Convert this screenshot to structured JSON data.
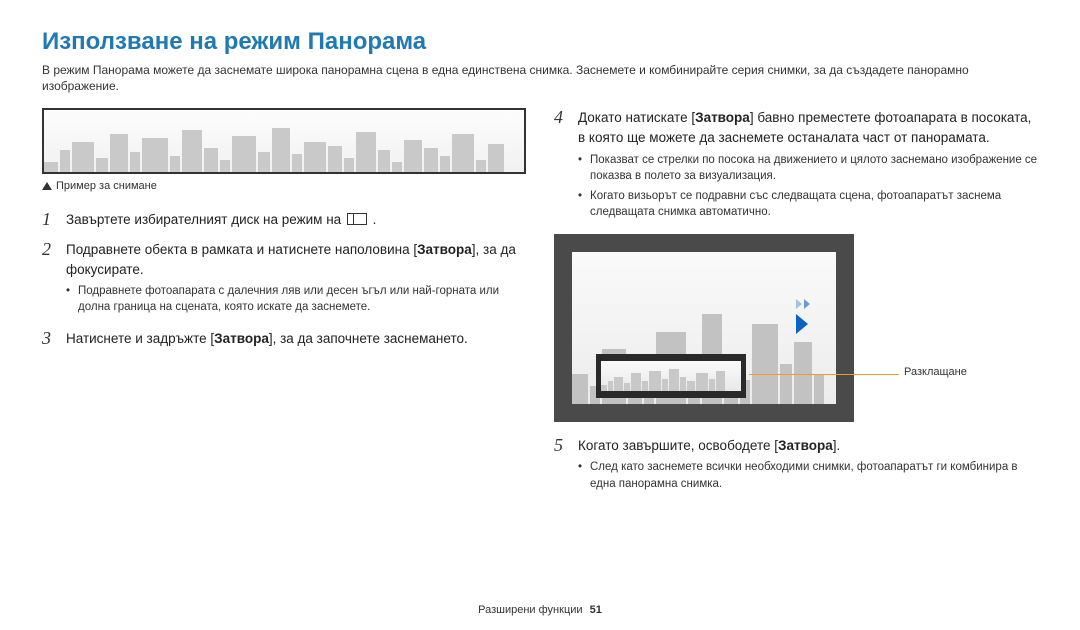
{
  "title": "Използване на режим Панорама",
  "intro": "В режим Панорама можете да заснемате широка панорамна сцена в една единствена снимка. Заснемете и комбинирайте серия снимки, за да създадете панорамно изображение.",
  "example_caption": "Пример за снимане",
  "steps_left": {
    "s1": "Завъртете избирателният диск на режим на ",
    "s1_after": " .",
    "s2_a": "Подравнете обекта в рамката и натиснете наполовина [",
    "s2_bold": "Затвора",
    "s2_b": "], за да фокусирате.",
    "s2_sub1": "Подравнете фотоапарата с далечния ляв или десен ъгъл или най-горната или долна граница на сцената, която искате да заснемете.",
    "s3_a": "Натиснете и задръжте [",
    "s3_bold": "Затвора",
    "s3_b": "], за да започнете заснемането."
  },
  "steps_right": {
    "s4_a": "Докато натискате [",
    "s4_bold": "Затвора",
    "s4_b": "] бавно преместете фотоапарата в посоката, в която ще можете да заснемете останалата част от панорамата.",
    "s4_sub1": "Показват се стрелки по посока на движението и цялото заснемано изображение се показва в полето за визуализация.",
    "s4_sub2": "Когато визьорът се подравни със следващата сцена, фотоапаратът заснема следващата снимка автоматично.",
    "s5_a": "Когато завършите, освободете [",
    "s5_bold": "Затвора",
    "s5_b": "].",
    "s5_sub1": "След като заснемете всички необходими снимки, фотоапаратът ги комбинира в една панорамна снимка."
  },
  "annotation": "Разклащане",
  "footer_section": "Разширени функции",
  "footer_page": "51"
}
